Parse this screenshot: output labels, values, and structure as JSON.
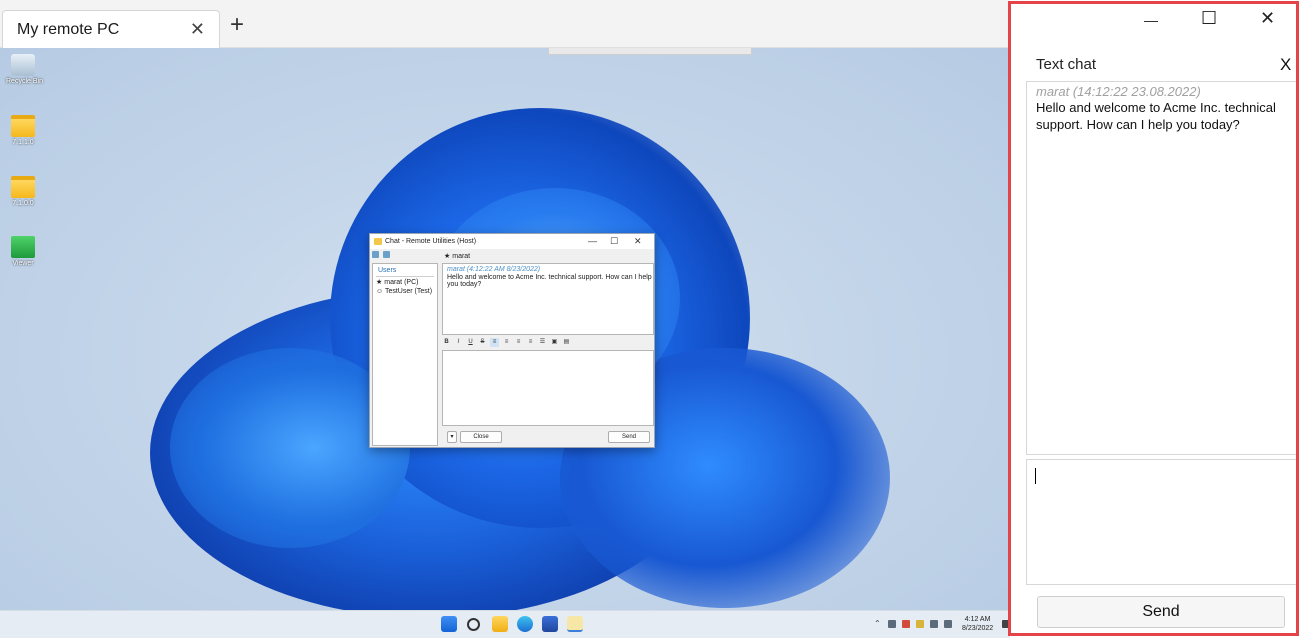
{
  "tab": {
    "title": "My remote PC",
    "close_glyph": "✕",
    "new_glyph": "+"
  },
  "desktop": {
    "icons": [
      {
        "label": "Recycle Bin",
        "icon": "recycle-bin-icon"
      },
      {
        "label": "7.1.1.0",
        "icon": "folder-icon"
      },
      {
        "label": "7.1.0.0",
        "icon": "folder-icon"
      },
      {
        "label": "Viewer",
        "icon": "viewer-app-icon"
      }
    ]
  },
  "host_chat": {
    "title": "Chat - Remote Utilities (Host)",
    "users_header": "Users",
    "users": [
      "marat (PC)",
      "TestUser (Test)"
    ],
    "peer": "marat",
    "message_meta": "marat (4:12:22 AM 8/23/2022)",
    "message_body": "Hello and welcome to Acme Inc. technical support. How can I help you today?",
    "fmt_buttons": [
      "B",
      "I",
      "U",
      "S"
    ],
    "close_label": "Close",
    "send_label": "Send",
    "menu_glyph": "▾"
  },
  "taskbar": {
    "time": "4:12 AM",
    "date": "8/23/2022"
  },
  "panel": {
    "minimize_glyph": "—",
    "maximize_glyph": "☐",
    "close_glyph": "✕",
    "title": "Text chat",
    "title_close": "X",
    "message_meta": "marat (14:12:22 23.08.2022)",
    "message_body": "Hello and welcome to Acme Inc. technical support. How can I help you today?",
    "send_label": "Send"
  },
  "colors": {
    "highlight": "#e4434a",
    "wallpaper_blue": "#1f6fe0"
  }
}
